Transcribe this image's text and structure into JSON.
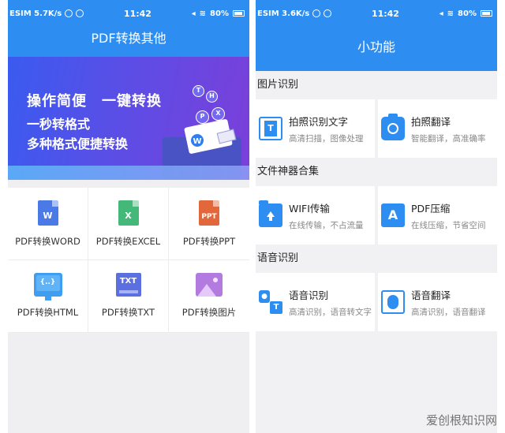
{
  "left": {
    "status": {
      "carrier": "ESIM 5.7K/s",
      "time": "11:42",
      "battery": "80%"
    },
    "title": "PDF转换其他",
    "banner": {
      "line1": "操作简便　一键转换",
      "line2": "一秒转格式",
      "line3": "多种格式便捷转换",
      "bubbles": [
        "T",
        "H",
        "P",
        "X"
      ],
      "badge": "W"
    },
    "tools": [
      {
        "label": "PDF转换WORD",
        "icon": "word-file-icon",
        "icon_text": "W"
      },
      {
        "label": "PDF转换EXCEL",
        "icon": "excel-file-icon",
        "icon_text": "X"
      },
      {
        "label": "PDF转换PPT",
        "icon": "ppt-file-icon",
        "icon_text": "PPT"
      },
      {
        "label": "PDF转换HTML",
        "icon": "html-monitor-icon",
        "icon_text": "{..}"
      },
      {
        "label": "PDF转换TXT",
        "icon": "txt-file-icon",
        "icon_text": "TXT"
      },
      {
        "label": "PDF转换图片",
        "icon": "image-file-icon",
        "icon_text": ""
      }
    ]
  },
  "right": {
    "status": {
      "carrier": "ESIM 3.6K/s",
      "time": "11:42",
      "battery": "80%"
    },
    "title": "小功能",
    "sections": [
      {
        "heading": "图片识别",
        "items": [
          {
            "name": "拍照识别文字",
            "desc": "高清扫描，图像处理",
            "icon": "photo-text-recognition-icon",
            "icon_text": "T"
          },
          {
            "name": "拍照翻译",
            "desc": "智能翻译，高准确率",
            "icon": "camera-icon",
            "icon_text": ""
          }
        ]
      },
      {
        "heading": "文件神器合集",
        "items": [
          {
            "name": "WIFI传输",
            "desc": "在线传输，不占流量",
            "icon": "folder-upload-icon",
            "icon_text": ""
          },
          {
            "name": "PDF压缩",
            "desc": "在线压缩，节省空间",
            "icon": "pdf-icon",
            "icon_text": "A"
          }
        ]
      },
      {
        "heading": "语音识别",
        "items": [
          {
            "name": "语音识别",
            "desc": "高清识别，语音转文字",
            "icon": "voice-to-text-icon",
            "icon_text": "T"
          },
          {
            "name": "语音翻译",
            "desc": "高清识别，语音翻译",
            "icon": "microphone-icon",
            "icon_text": ""
          }
        ]
      }
    ]
  },
  "watermark": "爱创根知识网",
  "colors": {
    "primary": "#2d8df0",
    "banner_start": "#3a5bf0",
    "banner_end": "#7b3fd9"
  }
}
